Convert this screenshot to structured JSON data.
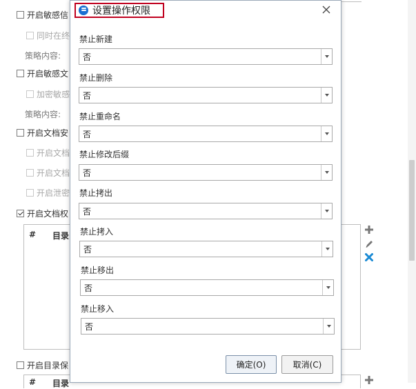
{
  "background": {
    "items": [
      {
        "label": "开启敏感信",
        "checked": false,
        "disabled": false
      },
      {
        "label": "同时在终",
        "checked": false,
        "disabled": true
      },
      {
        "label": "策略内容:"
      },
      {
        "label": "开启敏感文",
        "checked": false,
        "disabled": false
      },
      {
        "label": "加密敏感",
        "checked": false,
        "disabled": true
      },
      {
        "label": "策略内容:"
      },
      {
        "label": "开启文档安",
        "checked": false,
        "disabled": false
      },
      {
        "label": "开启文档",
        "checked": false,
        "disabled": true
      },
      {
        "label": "开启文档",
        "checked": false,
        "disabled": true
      },
      {
        "label": "开启泄密",
        "checked": false,
        "disabled": true
      },
      {
        "label": "开启文档权",
        "checked": true,
        "disabled": false
      },
      {
        "label": "开启目录保",
        "checked": false,
        "disabled": false
      }
    ],
    "table_headers": [
      "#",
      "目录"
    ],
    "table2_headers": [
      "#",
      "目录"
    ]
  },
  "dialog": {
    "title": "设置操作权限",
    "fields": [
      {
        "label": "禁止新建",
        "value": "否"
      },
      {
        "label": "禁止删除",
        "value": "否"
      },
      {
        "label": "禁止重命名",
        "value": "否"
      },
      {
        "label": "禁止修改后缀",
        "value": "否"
      },
      {
        "label": "禁止拷出",
        "value": "否"
      },
      {
        "label": "禁止拷入",
        "value": "否"
      },
      {
        "label": "禁止移出",
        "value": "否"
      },
      {
        "label": "禁止移入",
        "value": "否"
      }
    ],
    "ok_label": "确定(O)",
    "cancel_label": "取消(C)"
  },
  "colors": {
    "title_highlight": "#c0001e",
    "title_icon": "#1a6fd1",
    "delete_icon": "#1a8ad4"
  },
  "icons": [
    "add-icon",
    "edit-icon",
    "delete-icon",
    "close-icon",
    "chevron-down-icon"
  ]
}
